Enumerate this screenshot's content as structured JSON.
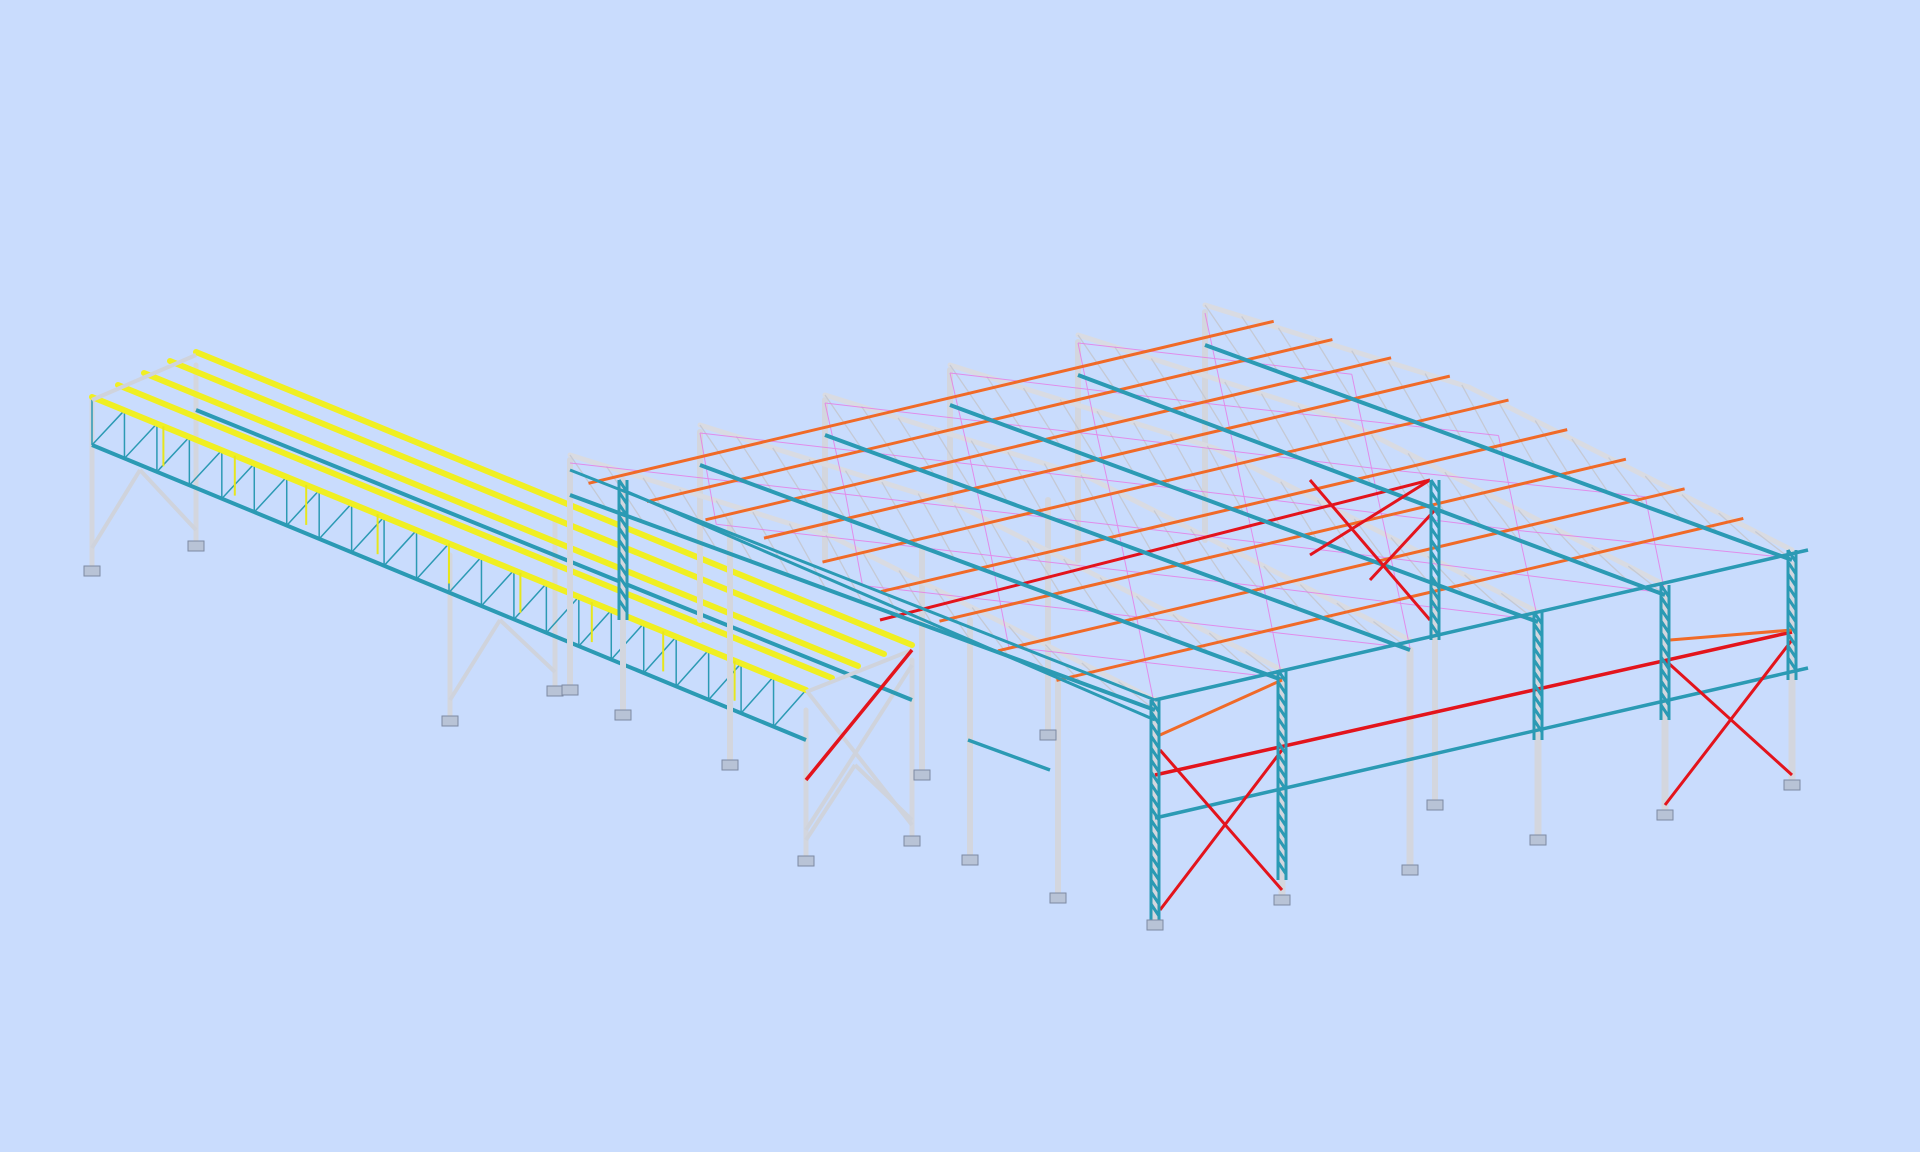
{
  "viewport": {
    "background": "#c9dcfd"
  },
  "model": {
    "members": [
      {
        "role": "column",
        "color": "#d4d7e0"
      },
      {
        "role": "truss-rafter",
        "color": "#d9dbe2"
      },
      {
        "role": "eave-beam",
        "color": "#2b9ab4"
      },
      {
        "role": "roof-purlin",
        "color": "#f06a28"
      },
      {
        "role": "wall-bracing",
        "color": "#e3141c"
      },
      {
        "role": "canopy-purlin",
        "color": "#f0f020"
      },
      {
        "role": "roof-bracing",
        "color": "#e679e6"
      },
      {
        "role": "base-plate",
        "color": "#b8c3d6"
      }
    ]
  }
}
